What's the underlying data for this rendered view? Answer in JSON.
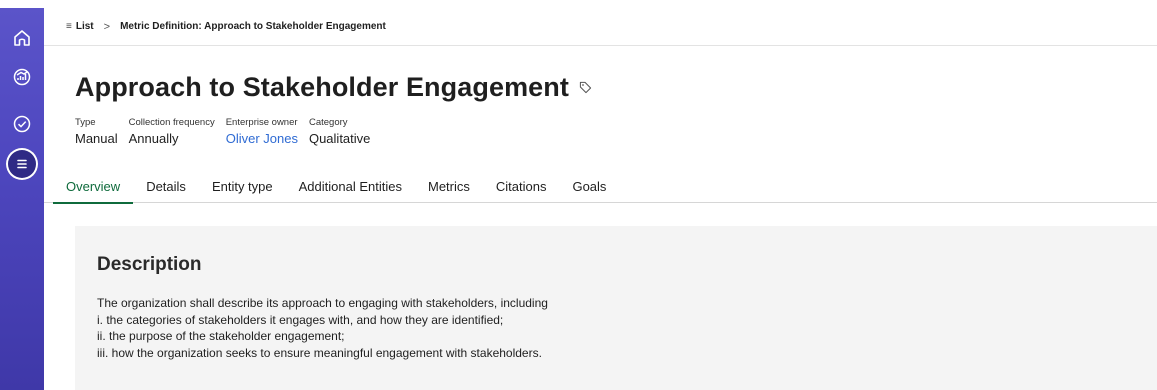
{
  "nav": {
    "icons": [
      "home-icon",
      "analytics-icon",
      "check-circle-icon",
      "list-icon"
    ]
  },
  "breadcrumb": {
    "list_label": "List",
    "separator": ">",
    "current": "Metric Definition: Approach to Stakeholder Engagement"
  },
  "header": {
    "title": "Approach to Stakeholder Engagement",
    "meta": [
      {
        "label": "Type",
        "value": "Manual"
      },
      {
        "label": "Collection frequency",
        "value": "Annually"
      },
      {
        "label": "Enterprise owner",
        "value": "Oliver Jones"
      },
      {
        "label": "Category",
        "value": "Qualitative"
      }
    ]
  },
  "tabs": [
    "Overview",
    "Details",
    "Entity type",
    "Additional Entities",
    "Metrics",
    "Citations",
    "Goals"
  ],
  "active_tab": "Overview",
  "description": {
    "heading": "Description",
    "lines": [
      "The organization shall describe its approach to engaging with stakeholders, including",
      "i. the categories of stakeholders it engages with, and how they are identified;",
      "ii. the purpose of the stakeholder engagement;",
      "iii. how the organization seeks to ensure meaningful engagement with stakeholders."
    ]
  },
  "colors": {
    "rail": "#5b54c9",
    "accent_tab": "#0f6b3c",
    "link": "#2f6bd3",
    "card_bg": "#f4f4f4"
  }
}
